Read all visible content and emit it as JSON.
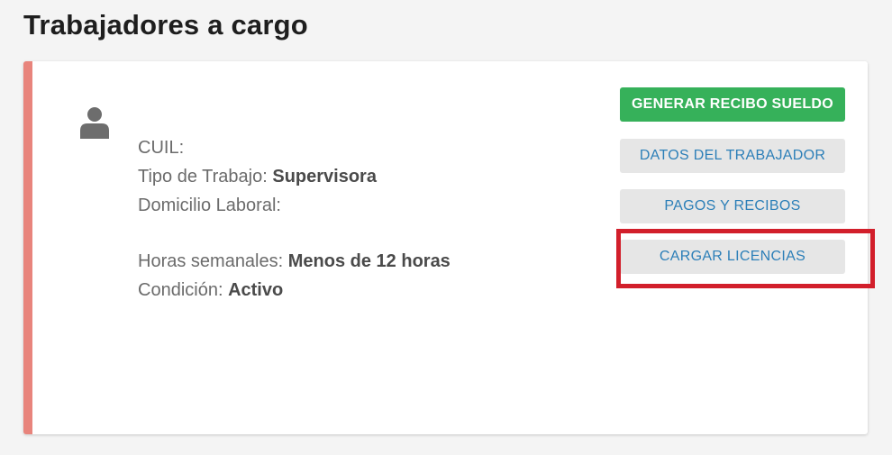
{
  "page": {
    "title": "Trabajadores a cargo"
  },
  "worker": {
    "cuil_label": "CUIL:",
    "cuil_value": "",
    "tipo_label": "Tipo de Trabajo: ",
    "tipo_value": "Supervisora",
    "domicilio_label": "Domicilio Laboral:",
    "domicilio_value": "",
    "horas_label": "Horas semanales: ",
    "horas_value": "Menos de 12 horas",
    "condicion_label": "Condición: ",
    "condicion_value": "Activo"
  },
  "actions": {
    "generar_recibo": "GENERAR RECIBO SUELDO",
    "datos_trabajador": "DATOS DEL TRABAJADOR",
    "pagos_recibos": "PAGOS Y RECIBOS",
    "cargar_licencias": "CARGAR LICENCIAS"
  },
  "colors": {
    "card_accent": "#e8847c",
    "primary_button": "#36b15a",
    "secondary_button": "#e6e6e6",
    "link_text": "#2c7fb8",
    "highlight_box": "#d21f2b"
  },
  "icons": {
    "avatar": "user-icon"
  }
}
